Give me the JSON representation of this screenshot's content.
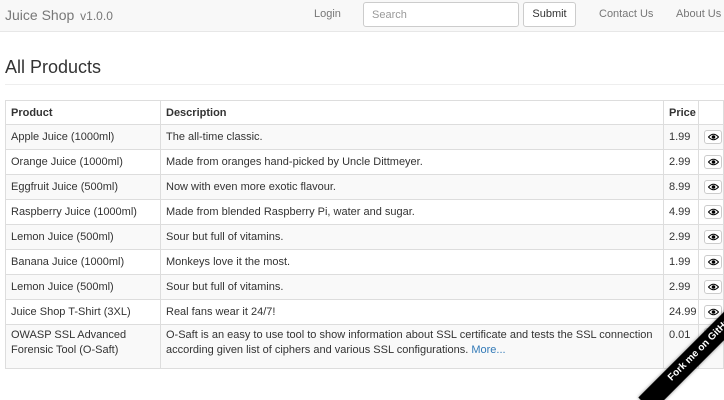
{
  "navbar": {
    "brand": "Juice Shop",
    "version": "v1.0.0",
    "login_label": "Login",
    "search_placeholder": "Search",
    "search_button": "Submit",
    "contact_label": "Contact Us",
    "about_label": "About Us"
  },
  "main": {
    "title": "All Products",
    "columns": [
      "Product",
      "Description",
      "Price"
    ],
    "rows": [
      {
        "product": "Apple Juice (1000ml)",
        "description": "The all-time classic.",
        "price": "1.99"
      },
      {
        "product": "Orange Juice (1000ml)",
        "description": "Made from oranges hand-picked by Uncle Dittmeyer.",
        "price": "2.99"
      },
      {
        "product": "Eggfruit Juice (500ml)",
        "description": "Now with even more exotic flavour.",
        "price": "8.99"
      },
      {
        "product": "Raspberry Juice (1000ml)",
        "description": "Made from blended Raspberry Pi, water and sugar.",
        "price": "4.99"
      },
      {
        "product": "Lemon Juice (500ml)",
        "description": "Sour but full of vitamins.",
        "price": "2.99"
      },
      {
        "product": "Banana Juice (1000ml)",
        "description": "Monkeys love it the most.",
        "price": "1.99"
      },
      {
        "product": "Lemon Juice (500ml)",
        "description": "Sour but full of vitamins.",
        "price": "2.99"
      },
      {
        "product": "Juice Shop T-Shirt (3XL)",
        "description": "Real fans wear it 24/7!",
        "price": "24.99"
      },
      {
        "product": "OWASP SSL Advanced Forensic Tool (O-Saft)",
        "description": "O-Saft is an easy to use tool to show information about SSL certificate and tests the SSL connection according given list of ciphers and various SSL configurations.",
        "more_label": "More...",
        "price": "0.01"
      }
    ],
    "row_action_icon": "eye-icon"
  },
  "ribbon": {
    "label": "Fork me on GitHub"
  },
  "colors": {
    "navbar_bg": "#f8f8f8",
    "link": "#337ab7",
    "ribbon": "#000000"
  }
}
